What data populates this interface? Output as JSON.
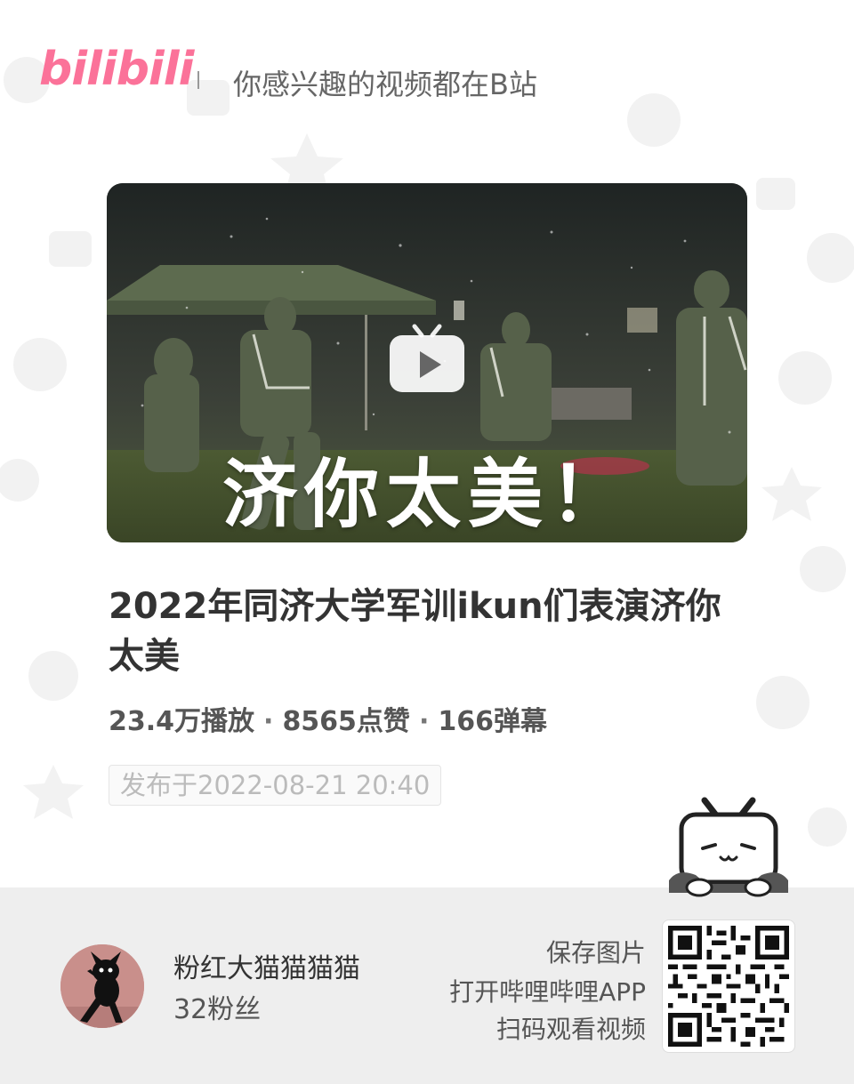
{
  "header": {
    "logo_text": "bilibili",
    "slogan": "你感兴趣的视频都在B站",
    "brand_color": "#fb7299"
  },
  "video": {
    "cover_caption": "济你太美！",
    "title": "2022年同济大学军训ikun们表演济你太美",
    "stats": {
      "plays": "23.4万播放",
      "likes": "8565点赞",
      "danmaku": "166弹幕",
      "separator": "·"
    },
    "publish_time": "发布于2022-08-21 20:40"
  },
  "uploader": {
    "name": "粉红大猫猫猫猫",
    "fans": "32粉丝"
  },
  "share": {
    "line1": "保存图片",
    "line2": "打开哔哩哔哩APP",
    "line3": "扫码观看视频"
  },
  "icons": {
    "play": "play-icon",
    "mascot": "bilibili-tv-mascot-icon",
    "qr": "qr-code-icon"
  }
}
